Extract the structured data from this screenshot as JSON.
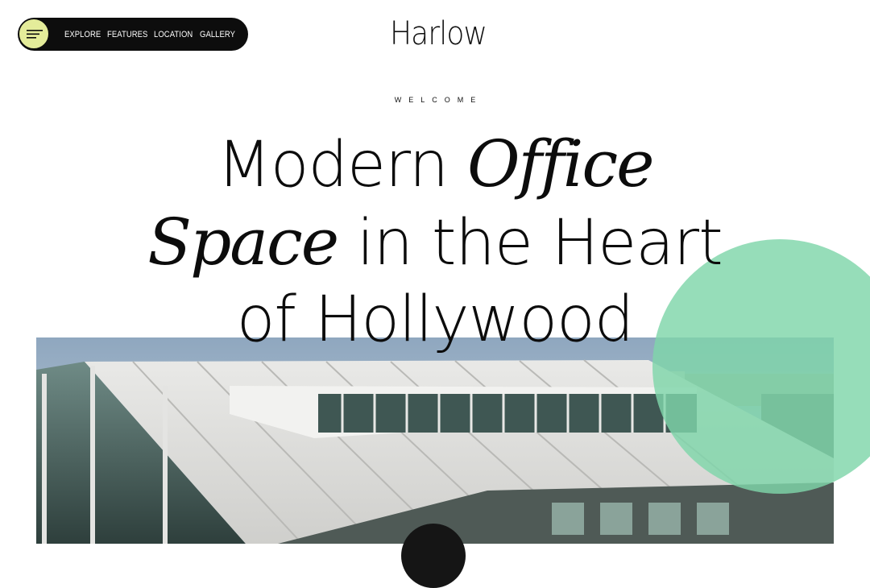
{
  "nav": {
    "menu_icon": "hamburger-icon",
    "links": [
      "EXPLORE",
      "FEATURES",
      "LOCATION",
      "GALLERY"
    ]
  },
  "logo": {
    "text": "Harlow"
  },
  "hero": {
    "eyebrow": "WELCOME",
    "headline": {
      "line1_regular": "Modern",
      "line1_italic": "Office",
      "line2_italic": "Space",
      "line2_regular": "in the Heart",
      "line3_regular": "of Hollywood"
    }
  },
  "colors": {
    "accent_pill": "#e4ec9a",
    "nav_background": "#0d0d0d",
    "circle_green": "#7fd6aa",
    "text": "#0c0c0c"
  }
}
